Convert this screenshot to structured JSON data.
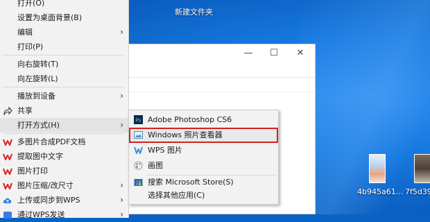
{
  "desktop": {
    "folder_label": "新建文件夹",
    "file1_label": "4b945a61...",
    "file2_label": "7f5d39"
  },
  "context_menu": {
    "items": [
      {
        "label": "打开(O)"
      },
      {
        "label": "设置为桌面背景(B)"
      },
      {
        "label": "编辑"
      },
      {
        "label": "打印(P)"
      },
      {
        "label": "向右旋转(T)"
      },
      {
        "label": "向左旋转(L)"
      },
      {
        "label": "播放到设备"
      },
      {
        "label": "共享"
      },
      {
        "label": "打开方式(H)"
      },
      {
        "label": "多图片合成PDF文档"
      },
      {
        "label": "提取图中文字"
      },
      {
        "label": "图片打印"
      },
      {
        "label": "图片压缩/改尺寸"
      },
      {
        "label": "上传或同步到WPS"
      },
      {
        "label": "通过WPS发送"
      }
    ],
    "submenu_arrow": "›"
  },
  "open_with_submenu": {
    "items": [
      {
        "label": "Adobe Photoshop CS6"
      },
      {
        "label": "Windows 照片查看器"
      },
      {
        "label": "WPS 图片"
      },
      {
        "label": "画图"
      },
      {
        "label": "搜索 Microsoft Store(S)"
      },
      {
        "label": "选择其他应用(C)"
      }
    ],
    "highlighted_index": 1,
    "highlight_color": "#d42020"
  },
  "background_window": {
    "minimize": "—",
    "maximize": "☐",
    "close": "✕"
  }
}
